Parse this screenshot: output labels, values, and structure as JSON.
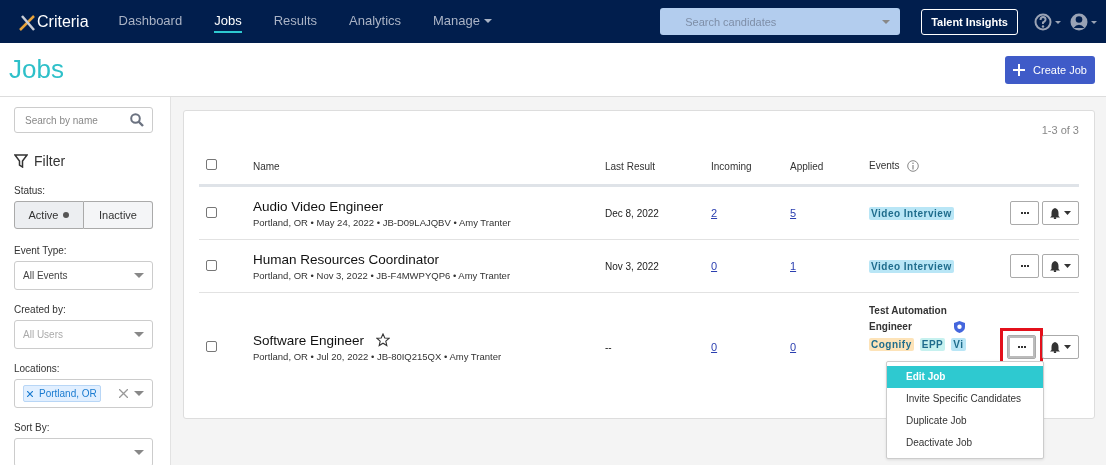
{
  "nav": {
    "logo": "Criteria",
    "items": [
      {
        "label": "Dashboard",
        "selected": false,
        "dropdown": false
      },
      {
        "label": "Jobs",
        "selected": true,
        "dropdown": false
      },
      {
        "label": "Results",
        "selected": false,
        "dropdown": false
      },
      {
        "label": "Analytics",
        "selected": false,
        "dropdown": false
      },
      {
        "label": "Manage",
        "selected": false,
        "dropdown": true
      }
    ],
    "search": {
      "placeholder": "Search candidates"
    },
    "insights_button": "Talent Insights"
  },
  "page": {
    "title": "Jobs",
    "create_button": "Create Job"
  },
  "sidebar": {
    "search": {
      "placeholder": "Search by name"
    },
    "filter_label": "Filter",
    "status": {
      "label": "Status:",
      "options": [
        {
          "label": "Active",
          "selected": true
        },
        {
          "label": "Inactive",
          "selected": false
        }
      ]
    },
    "filters": [
      {
        "kind": "select",
        "label": "Event Type:",
        "value": "All Events"
      },
      {
        "kind": "select",
        "label": "Created by:",
        "placeholder": "All Users"
      },
      {
        "kind": "tags",
        "label": "Locations:",
        "tags": [
          "Portland, OR"
        ]
      },
      {
        "kind": "select",
        "label": "Sort By:"
      }
    ]
  },
  "table": {
    "count": "1-3 of 3",
    "all_checked": false,
    "columns": [
      "Name",
      "Last Result",
      "Incoming",
      "Applied",
      "Events"
    ],
    "rows": [
      {
        "name": "Audio Video Engineer",
        "meta": "Portland, OR • May 24, 2022 • JB-D09LAJQBV • Amy Tranter",
        "checked": false,
        "last_result": "Dec 8, 2022",
        "incoming": "2",
        "applied": "5",
        "events": [
          {
            "label": "Video Interview",
            "color": "#b9e6f6"
          }
        ],
        "highlighted": false
      },
      {
        "name": "Human Resources Coordinator",
        "meta": "Portland, OR • Nov 3, 2022 • JB-F4MWPYQP6 • Amy Tranter",
        "checked": false,
        "last_result": "Nov 3, 2022",
        "incoming": "0",
        "applied": "1",
        "events": [
          {
            "label": "Video Interview",
            "color": "#b9e6f6"
          }
        ],
        "highlighted": false
      },
      {
        "name": "Software Engineer",
        "favorite": false,
        "meta": "Portland, OR • Jul 20, 2022 • JB-80IQ215QX • Amy Tranter",
        "checked": false,
        "last_result": "--",
        "incoming": "0",
        "applied": "0",
        "event_title": "Test Automation Engineer",
        "verified": true,
        "events": [
          {
            "label": "Cognify",
            "color": "#fde3b8"
          },
          {
            "label": "EPP",
            "color": "#c6f1ef"
          },
          {
            "label": "Vi",
            "color": "#b9e6f6"
          }
        ],
        "highlighted": true,
        "menu": [
          {
            "label": "Edit Job",
            "selected": true
          },
          {
            "label": "Invite Specific Candidates",
            "selected": false
          },
          {
            "label": "Duplicate Job",
            "selected": false
          },
          {
            "label": "Deactivate Job",
            "selected": false
          }
        ]
      }
    ]
  }
}
